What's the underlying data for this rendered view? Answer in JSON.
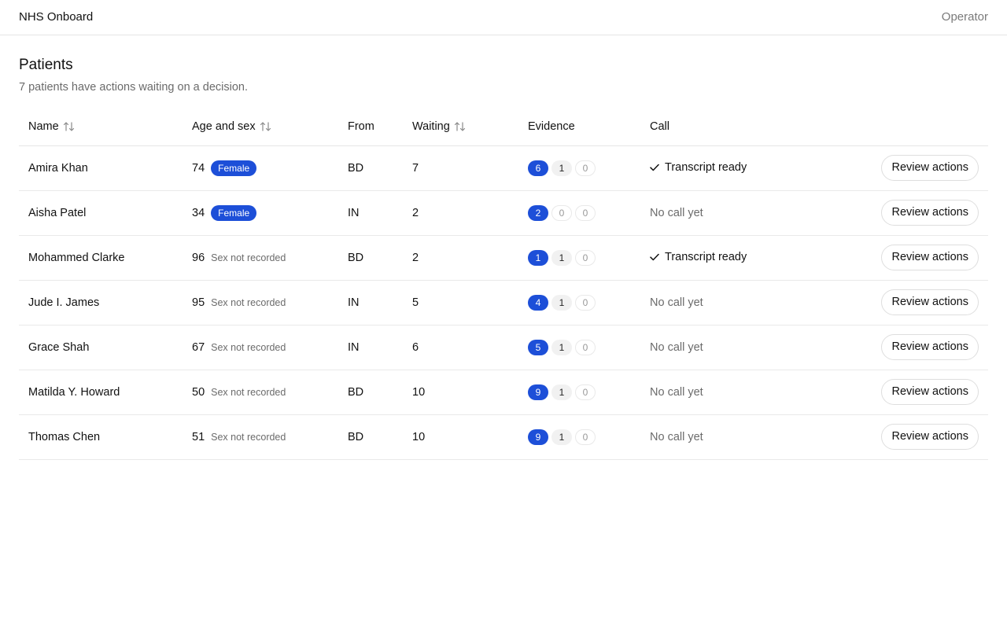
{
  "header": {
    "brand": "NHS Onboard",
    "user": "Operator"
  },
  "page": {
    "title": "Patients",
    "subtitle": "7 patients have actions waiting on a decision."
  },
  "table": {
    "columns": {
      "name": "Name",
      "age_sex": "Age and sex",
      "from": "From",
      "waiting": "Waiting",
      "evidence": "Evidence",
      "call": "Call"
    },
    "rows": [
      {
        "name": "Amira Khan",
        "age": "74",
        "sex": "Female",
        "sex_recorded": true,
        "from": "BD",
        "waiting": "7",
        "evidence": [
          "6",
          "1",
          "0"
        ],
        "call": "Transcript ready",
        "call_ready": true,
        "action": "Review actions"
      },
      {
        "name": "Aisha Patel",
        "age": "34",
        "sex": "Female",
        "sex_recorded": true,
        "from": "IN",
        "waiting": "2",
        "evidence": [
          "2",
          "0",
          "0"
        ],
        "call": "No call yet",
        "call_ready": false,
        "action": "Review actions"
      },
      {
        "name": "Mohammed Clarke",
        "age": "96",
        "sex": "Sex not recorded",
        "sex_recorded": false,
        "from": "BD",
        "waiting": "2",
        "evidence": [
          "1",
          "1",
          "0"
        ],
        "call": "Transcript ready",
        "call_ready": true,
        "action": "Review actions"
      },
      {
        "name": "Jude I. James",
        "age": "95",
        "sex": "Sex not recorded",
        "sex_recorded": false,
        "from": "IN",
        "waiting": "5",
        "evidence": [
          "4",
          "1",
          "0"
        ],
        "call": "No call yet",
        "call_ready": false,
        "action": "Review actions"
      },
      {
        "name": "Grace Shah",
        "age": "67",
        "sex": "Sex not recorded",
        "sex_recorded": false,
        "from": "IN",
        "waiting": "6",
        "evidence": [
          "5",
          "1",
          "0"
        ],
        "call": "No call yet",
        "call_ready": false,
        "action": "Review actions"
      },
      {
        "name": "Matilda Y. Howard",
        "age": "50",
        "sex": "Sex not recorded",
        "sex_recorded": false,
        "from": "BD",
        "waiting": "10",
        "evidence": [
          "9",
          "1",
          "0"
        ],
        "call": "No call yet",
        "call_ready": false,
        "action": "Review actions"
      },
      {
        "name": "Thomas Chen",
        "age": "51",
        "sex": "Sex not recorded",
        "sex_recorded": false,
        "from": "BD",
        "waiting": "10",
        "evidence": [
          "9",
          "1",
          "0"
        ],
        "call": "No call yet",
        "call_ready": false,
        "action": "Review actions"
      }
    ]
  },
  "icons": {
    "sort": "sort-arrows-icon",
    "check": "check-icon"
  },
  "colors": {
    "accent": "#1d4fd8",
    "muted_text": "#6b6b6b",
    "border": "#e5e5e5"
  }
}
